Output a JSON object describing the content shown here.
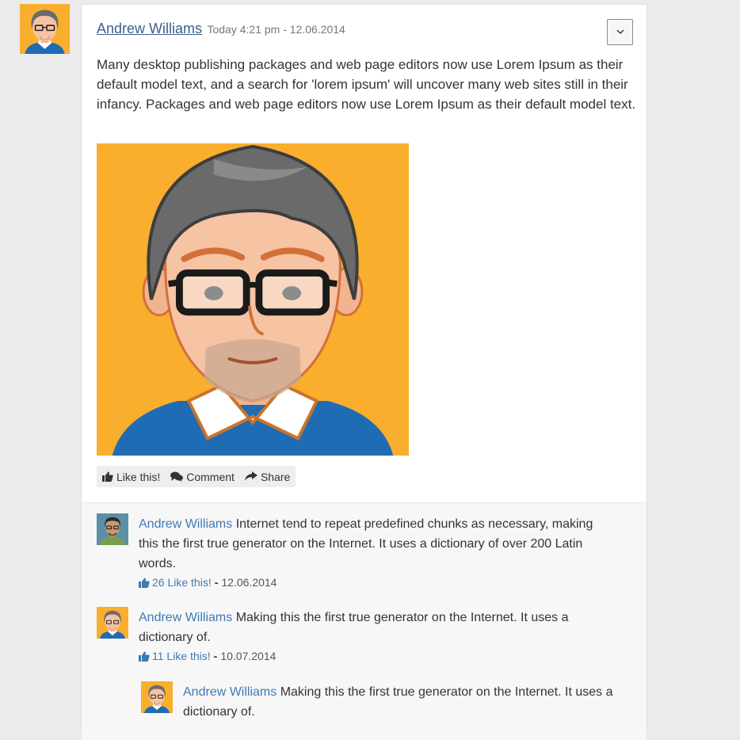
{
  "post": {
    "author": "Andrew Williams",
    "time": "Today 4:21 pm - 12.06.2014",
    "text": "Many desktop publishing packages and web page editors now use Lorem Ipsum as their default model text, and a search for 'lorem ipsum' will uncover many web sites still in their infancy. Packages and web page editors now use Lorem Ipsum as their default model text.",
    "actions": {
      "like": "Like this!",
      "comment": "Comment",
      "share": "Share"
    }
  },
  "comments": [
    {
      "author": "Andrew Williams",
      "text": "Internet tend to repeat predefined chunks as necessary, making this the first true generator on the Internet. It uses a dictionary of over 200 Latin words.",
      "likes": "26 Like this!",
      "date": "12.06.2014"
    },
    {
      "author": "Andrew Williams",
      "text": "Making this the first true generator on the Internet. It uses a dictionary of.",
      "likes": "11 Like this!",
      "date": "10.07.2014"
    },
    {
      "author": "Andrew Williams",
      "text": "Making this the first true generator on the Internet. It uses a dictionary of."
    }
  ],
  "icons": {
    "like": "thumbs-up-icon",
    "comment": "comments-icon",
    "share": "share-arrow-icon",
    "dropdown": "chevron-down-icon"
  },
  "colors": {
    "link": "#337ab7",
    "avatar_bg": "#f9ae2e",
    "sweater": "#1f6cb5"
  }
}
